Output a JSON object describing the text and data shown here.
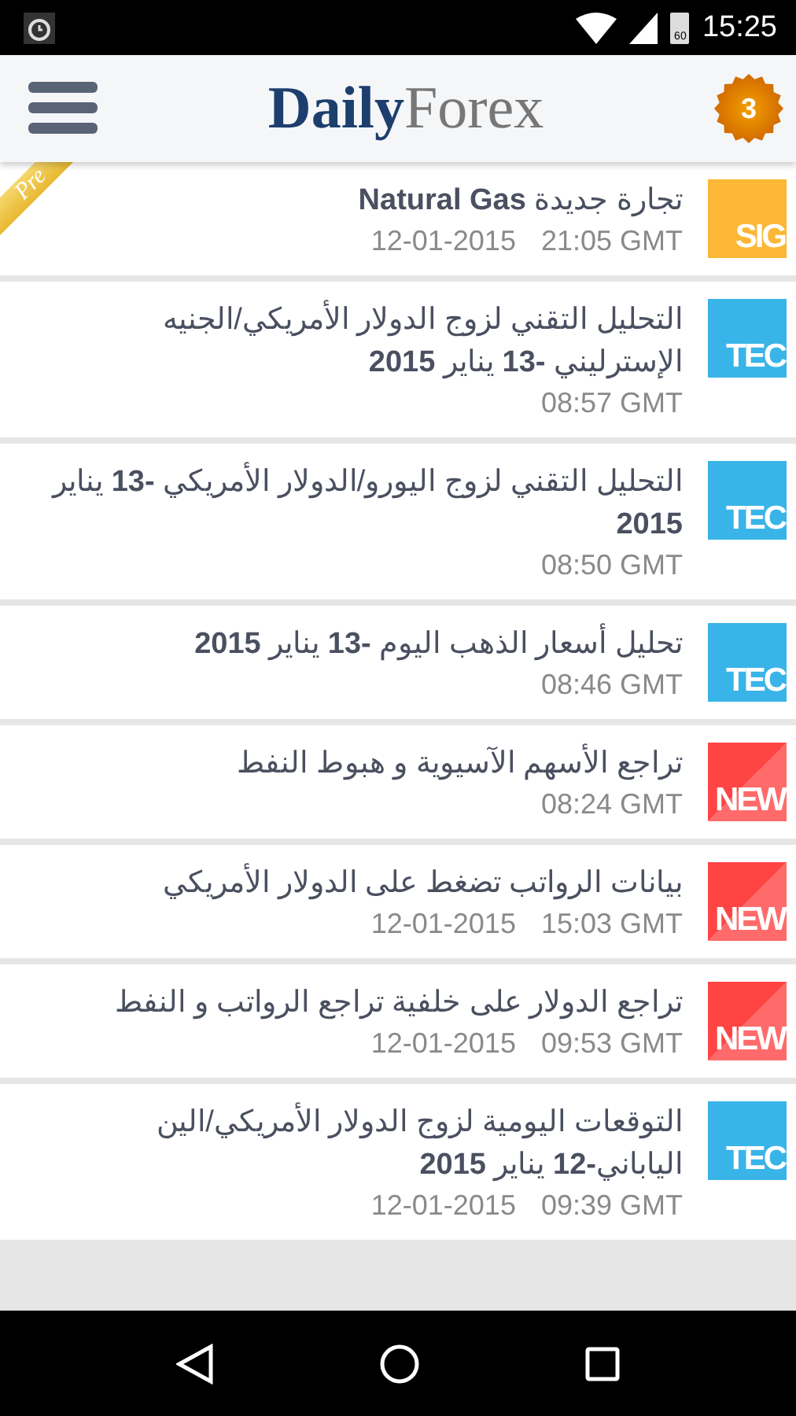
{
  "status_bar": {
    "battery": "60",
    "time": "15:25"
  },
  "app_bar": {
    "logo_bold": "Daily",
    "logo_light": "Forex",
    "badge": "3"
  },
  "items": [
    {
      "title": "تجارة جديدة **Natural Gas**",
      "date": "12-01-2015",
      "time": "21:05 GMT",
      "tile": {
        "kind": "sig",
        "label": "SIG"
      },
      "ribbon": "Pre"
    },
    {
      "title": "التحليل التقني لزوج الدولار الأمريكي/الجنيه الإسترليني **-13** يناير **2015**",
      "time": "08:57 GMT",
      "tile": {
        "kind": "tec",
        "label": "TEC"
      }
    },
    {
      "title": "التحليل التقني لزوج اليورو/الدولار الأمريكي **-13** يناير **2015**",
      "time": "08:50 GMT",
      "tile": {
        "kind": "tec",
        "label": "TEC"
      }
    },
    {
      "title": "تحليل أسعار الذهب اليوم **-13** يناير **2015**",
      "time": "08:46 GMT",
      "tile": {
        "kind": "tec",
        "label": "TEC"
      }
    },
    {
      "title": "تراجع الأسهم الآسيوية و هبوط النفط",
      "time": "08:24 GMT",
      "tile": {
        "kind": "new",
        "label": "NEW"
      }
    },
    {
      "title": "بيانات الرواتب تضغط على الدولار الأمريكي",
      "date": "12-01-2015",
      "time": "15:03 GMT",
      "tile": {
        "kind": "new",
        "label": "NEW"
      }
    },
    {
      "title": "تراجع الدولار على خلفية تراجع الرواتب و النفط",
      "date": "12-01-2015",
      "time": "09:53 GMT",
      "tile": {
        "kind": "new",
        "label": "NEW"
      }
    },
    {
      "title": "التوقعات اليومية لزوج الدولار الأمريكي/الين الياباني**-12** يناير **2015**",
      "date": "12-01-2015",
      "time": "09:39 GMT",
      "tile": {
        "kind": "tec",
        "label": "TEC"
      }
    }
  ]
}
